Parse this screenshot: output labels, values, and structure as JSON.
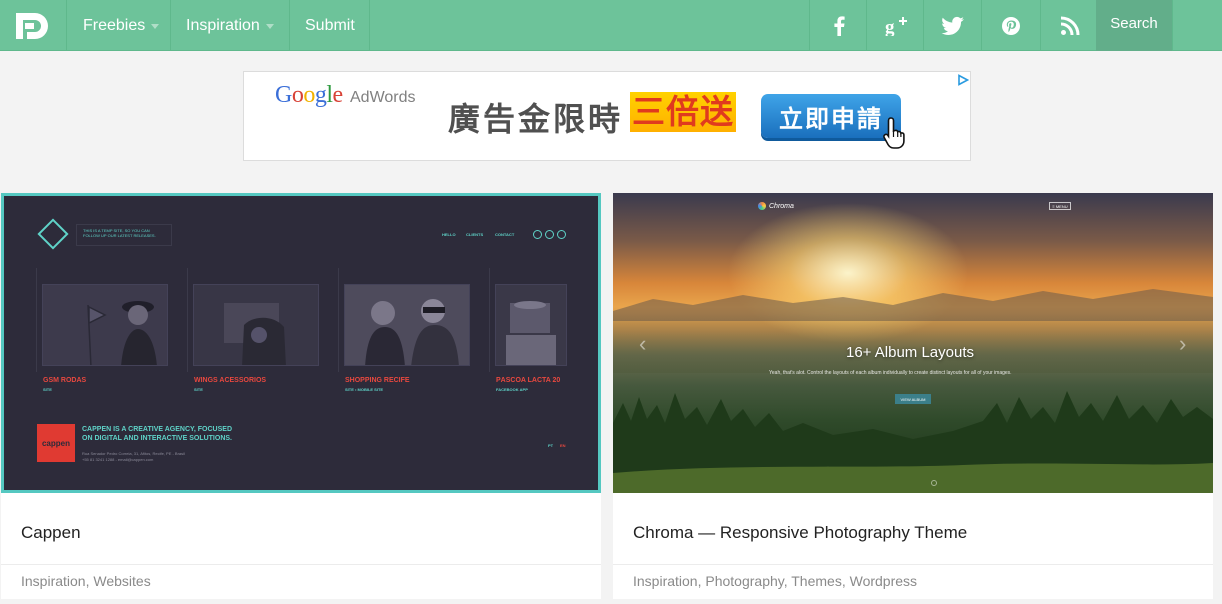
{
  "nav": {
    "items": [
      {
        "label": "Freebies",
        "dropdown": true
      },
      {
        "label": "Inspiration",
        "dropdown": true
      },
      {
        "label": "Submit",
        "dropdown": false
      }
    ],
    "social": [
      "facebook-icon",
      "google-plus-icon",
      "twitter-icon",
      "pinterest-icon",
      "rss-icon"
    ],
    "search_label": "Search",
    "colors": {
      "bar": "#6dc39a",
      "search_bg": "#62ae8a"
    }
  },
  "ad": {
    "google": "Google",
    "adwords": "AdWords",
    "headline": "廣告金限時",
    "highlight": "三倍送",
    "cta": "立即申請"
  },
  "cards": [
    {
      "title": "Cappen",
      "tags": "Inspiration, Websites",
      "preview": {
        "tagline": "THIS IS A TEMP SITE, SO YOU CAN FOLLOW UP OUR LATEST RELEASES.",
        "nav": [
          "HELLO",
          "CLIENTS",
          "CONTACT"
        ],
        "projects": [
          {
            "title": "GSM RODAS",
            "sub": "SITE"
          },
          {
            "title": "WINGS ACESSORIOS",
            "sub": "SITE"
          },
          {
            "title": "SHOPPING RECIFE",
            "sub": "SITE • MOBILE SITE"
          },
          {
            "title": "PÁSCOA LACTA 20",
            "sub": "FACEBOOK APP"
          }
        ],
        "logo": "cappen",
        "agency": [
          "CAPPEN IS A CREATIVE AGENCY, FOCUSED",
          "ON DIGITAL AND INTERACTIVE SOLUTIONS."
        ],
        "address": [
          "Rua Senador Pedro Correia, 31, Afitos, Recife, PE - Brasil",
          "+55 81 3241 1288 - email@cappen.com"
        ],
        "lang": [
          "PT",
          "EN"
        ]
      }
    },
    {
      "title": "Chroma — Responsive Photography Theme",
      "tags": "Inspiration, Photography, Themes, Wordpress",
      "preview": {
        "logo": "Chroma",
        "menu": "≡ MENU",
        "heading": "16+ Album Layouts",
        "sub": "Yeah, that's alot. Control the layouts of each album individually to create distinct layouts for all of your images.",
        "button": "VIEW ALBUM"
      }
    }
  ]
}
